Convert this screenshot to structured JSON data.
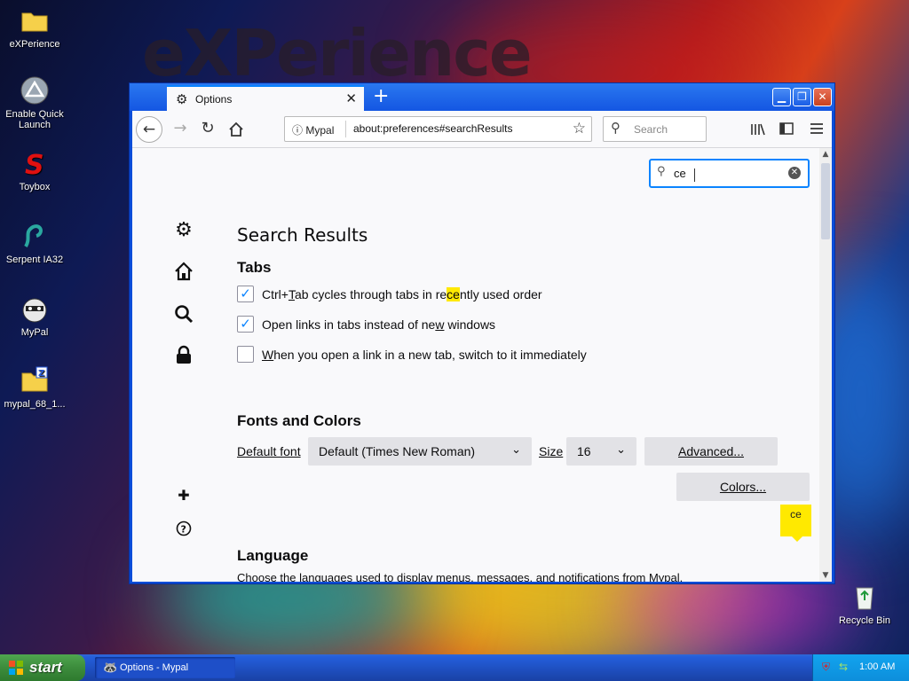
{
  "desktop": {
    "wallpaper_brand": "eXPerience",
    "icons": [
      {
        "label": "eXPerience"
      },
      {
        "label": "Enable Quick Launch"
      },
      {
        "label": "Toybox"
      },
      {
        "label": "Serpent IA32"
      },
      {
        "label": "MyPal"
      },
      {
        "label": "mypal_68_1..."
      },
      {
        "label": "Recycle Bin"
      }
    ]
  },
  "window": {
    "tab_title": "Options",
    "tab_close": "✕",
    "new_tab": "+",
    "controls": {
      "minimize": "_",
      "maximize": "□",
      "close": "✕"
    }
  },
  "navbar": {
    "identity": "Mypal",
    "url": "about:preferences#searchResults",
    "search_placeholder": "Search"
  },
  "prefs": {
    "find_value": "ce",
    "heading": "Search Results",
    "tabs_section": {
      "title": "Tabs",
      "options": [
        {
          "pre": "Ctrl+",
          "u": "T",
          "mid": "ab cycles through tabs in re",
          "hl": "ce",
          "post": "ntly used order",
          "checked": true
        },
        {
          "pre": "Open links in tabs instead of ne",
          "u": "w",
          "post": " windows",
          "checked": true
        },
        {
          "pre": "",
          "u": "W",
          "post": "hen you open a link in a new tab, switch to it immediately",
          "checked": false
        }
      ]
    },
    "fonts_section": {
      "title": "Fonts and Colors",
      "default_font_label": "Default font",
      "default_font_value": "Default (Times New Roman)",
      "size_label": "Size",
      "size_value": "16",
      "advanced_label": "Advanced...",
      "colors_label": "Colors...",
      "tooltip": "ce"
    },
    "language_section": {
      "title": "Language",
      "description": "Choose the languages used to display menus, messages, and notifications from Mypal."
    }
  },
  "taskbar": {
    "start_label": "start",
    "task": "Options - Mypal",
    "clock": "1:00 AM"
  },
  "colors": {
    "accent": "#0a84ff",
    "highlight": "#ffe900",
    "xp_blue": "#245edb",
    "start_green": "#3c8c3c"
  }
}
